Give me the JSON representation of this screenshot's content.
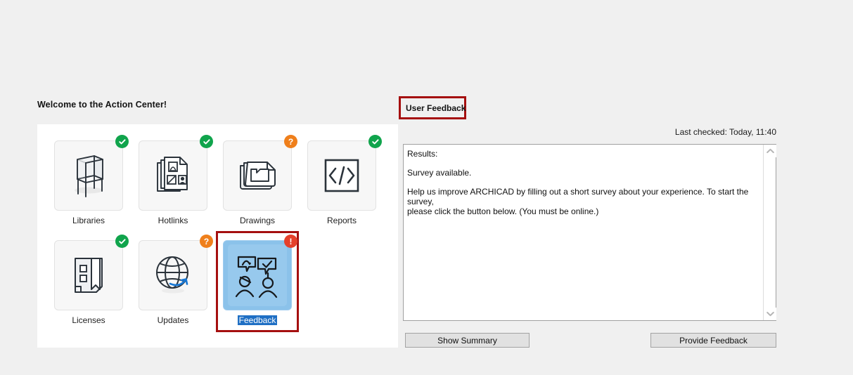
{
  "window": {
    "background_color": "#f0f0f0"
  },
  "left_panel": {
    "heading": "Welcome to the Action Center!",
    "tiles": [
      {
        "label": "Libraries",
        "status": "ok",
        "icon": "chair-icon",
        "selected": false
      },
      {
        "label": "Hotlinks",
        "status": "ok",
        "icon": "documents-icon",
        "selected": false
      },
      {
        "label": "Drawings",
        "status": "warn",
        "icon": "drawing-sheets-icon",
        "selected": false
      },
      {
        "label": "Reports",
        "status": "ok",
        "icon": "code-brackets-icon",
        "selected": false
      },
      {
        "label": "Licenses",
        "status": "ok",
        "icon": "license-page-icon",
        "selected": false
      },
      {
        "label": "Updates",
        "status": "warn",
        "icon": "globe-refresh-icon",
        "selected": false
      },
      {
        "label": "Feedback",
        "status": "alert",
        "icon": "two-people-chat-icon",
        "selected": true
      }
    ],
    "status_glyphs": {
      "ok": "check-circle-icon",
      "warn": "question-circle-icon",
      "alert": "exclamation-circle-icon"
    },
    "status_colors": {
      "ok": "#10a44c",
      "warn": "#ef7f1b",
      "alert": "#e5402b"
    },
    "selection_colors": {
      "frame": "#a50f0f",
      "tile_fill": "#8bc2ea",
      "label_highlight": "#1f6fc4",
      "label_text": "#ffffff"
    }
  },
  "right_panel": {
    "tab": {
      "label": "User Feedback",
      "highlight_color": "#a50f0f"
    },
    "last_checked": "Last checked: Today, 11:40",
    "results": {
      "line1": "Results:",
      "line2": "Survey available.",
      "line3": "Help us improve ARCHICAD by filling out a short survey about your experience. To start the survey,\nplease click the button below. (You must be online.)"
    },
    "scrollbar": {
      "up_icon": "chevron-up-icon",
      "down_icon": "chevron-down-icon"
    },
    "buttons": {
      "show_summary": "Show Summary",
      "provide_feedback": "Provide Feedback"
    }
  }
}
